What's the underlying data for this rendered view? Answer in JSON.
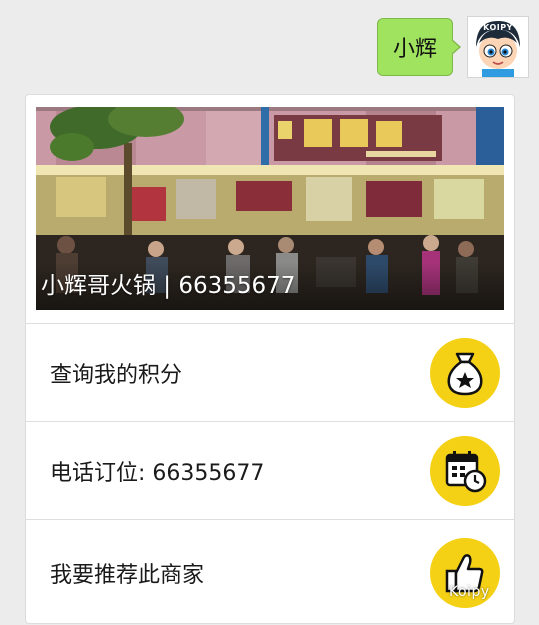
{
  "chat": {
    "message": "小辉",
    "avatar_tag": "KOIPY"
  },
  "card": {
    "banner_title": "小辉哥火锅 | 66355677",
    "rows": [
      {
        "label": "查询我的积分",
        "icon": "money-bag-star-icon"
      },
      {
        "label": "电话订位: 66355677",
        "icon": "calendar-clock-icon"
      },
      {
        "label": "我要推荐此商家",
        "icon": "thumbs-up-icon"
      }
    ]
  },
  "watermark": "Koipy",
  "colors": {
    "bubble": "#9fe35f",
    "icon_circle": "#f5d116",
    "background": "#ececec"
  }
}
